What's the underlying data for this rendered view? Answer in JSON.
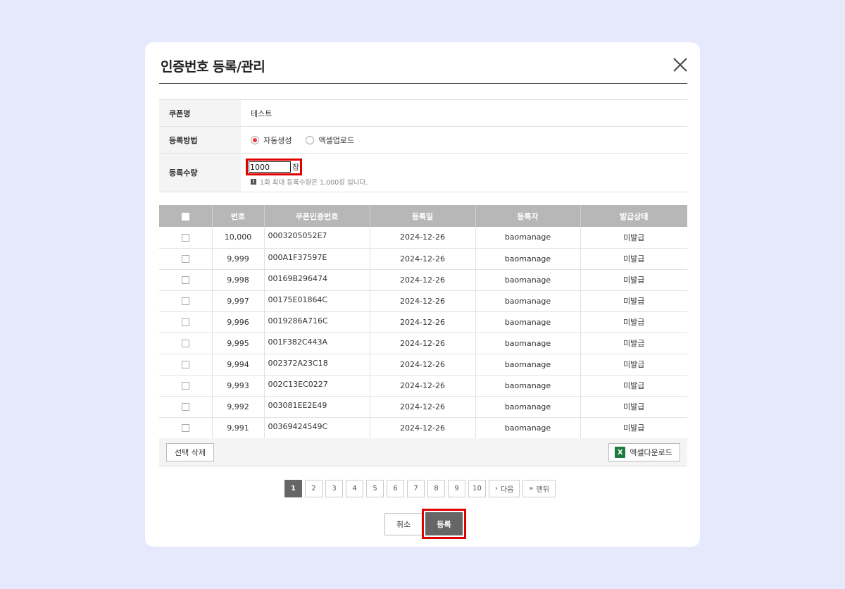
{
  "modal": {
    "title": "인증번호 등록/관리"
  },
  "form": {
    "coupon_label": "쿠폰명",
    "coupon_value": "테스트",
    "method_label": "등록방법",
    "method_options": [
      "자동생성",
      "엑셀업로드"
    ],
    "method_selected": "자동생성",
    "qty_label": "등록수량",
    "qty_value": "1000",
    "qty_unit": "장",
    "qty_note": "1회 최대 등록수량은 1,000장 입니다."
  },
  "table": {
    "headers": [
      "번호",
      "쿠폰인증번호",
      "등록일",
      "등록자",
      "발급상태"
    ],
    "rows": [
      [
        "10,000",
        "0003205052E7",
        "2024-12-26",
        "baomanage",
        "미발급"
      ],
      [
        "9,999",
        "000A1F37597E",
        "2024-12-26",
        "baomanage",
        "미발급"
      ],
      [
        "9,998",
        "00169B296474",
        "2024-12-26",
        "baomanage",
        "미발급"
      ],
      [
        "9,997",
        "00175E01864C",
        "2024-12-26",
        "baomanage",
        "미발급"
      ],
      [
        "9,996",
        "0019286A716C",
        "2024-12-26",
        "baomanage",
        "미발급"
      ],
      [
        "9,995",
        "001F382C443A",
        "2024-12-26",
        "baomanage",
        "미발급"
      ],
      [
        "9,994",
        "002372A23C18",
        "2024-12-26",
        "baomanage",
        "미발급"
      ],
      [
        "9,993",
        "002C13EC0227",
        "2024-12-26",
        "baomanage",
        "미발급"
      ],
      [
        "9,992",
        "003081EE2E49",
        "2024-12-26",
        "baomanage",
        "미발급"
      ],
      [
        "9,991",
        "00369424549C",
        "2024-12-26",
        "baomanage",
        "미발급"
      ]
    ],
    "delete_label": "선택 삭제",
    "excel_label": "엑셀다운로드",
    "excel_icon_letter": "X"
  },
  "pagination": {
    "pages": [
      "1",
      "2",
      "3",
      "4",
      "5",
      "6",
      "7",
      "8",
      "9",
      "10"
    ],
    "current": "1",
    "next_label": "다음",
    "last_label": "맨뒤"
  },
  "actions": {
    "cancel_label": "취소",
    "register_label": "등록"
  },
  "colors": {
    "background": "#e6e8fb",
    "header_gray": "#b7b7b7",
    "highlight_red": "#e00000",
    "radio_red": "#e53935",
    "excel_green": "#1e7b40"
  }
}
